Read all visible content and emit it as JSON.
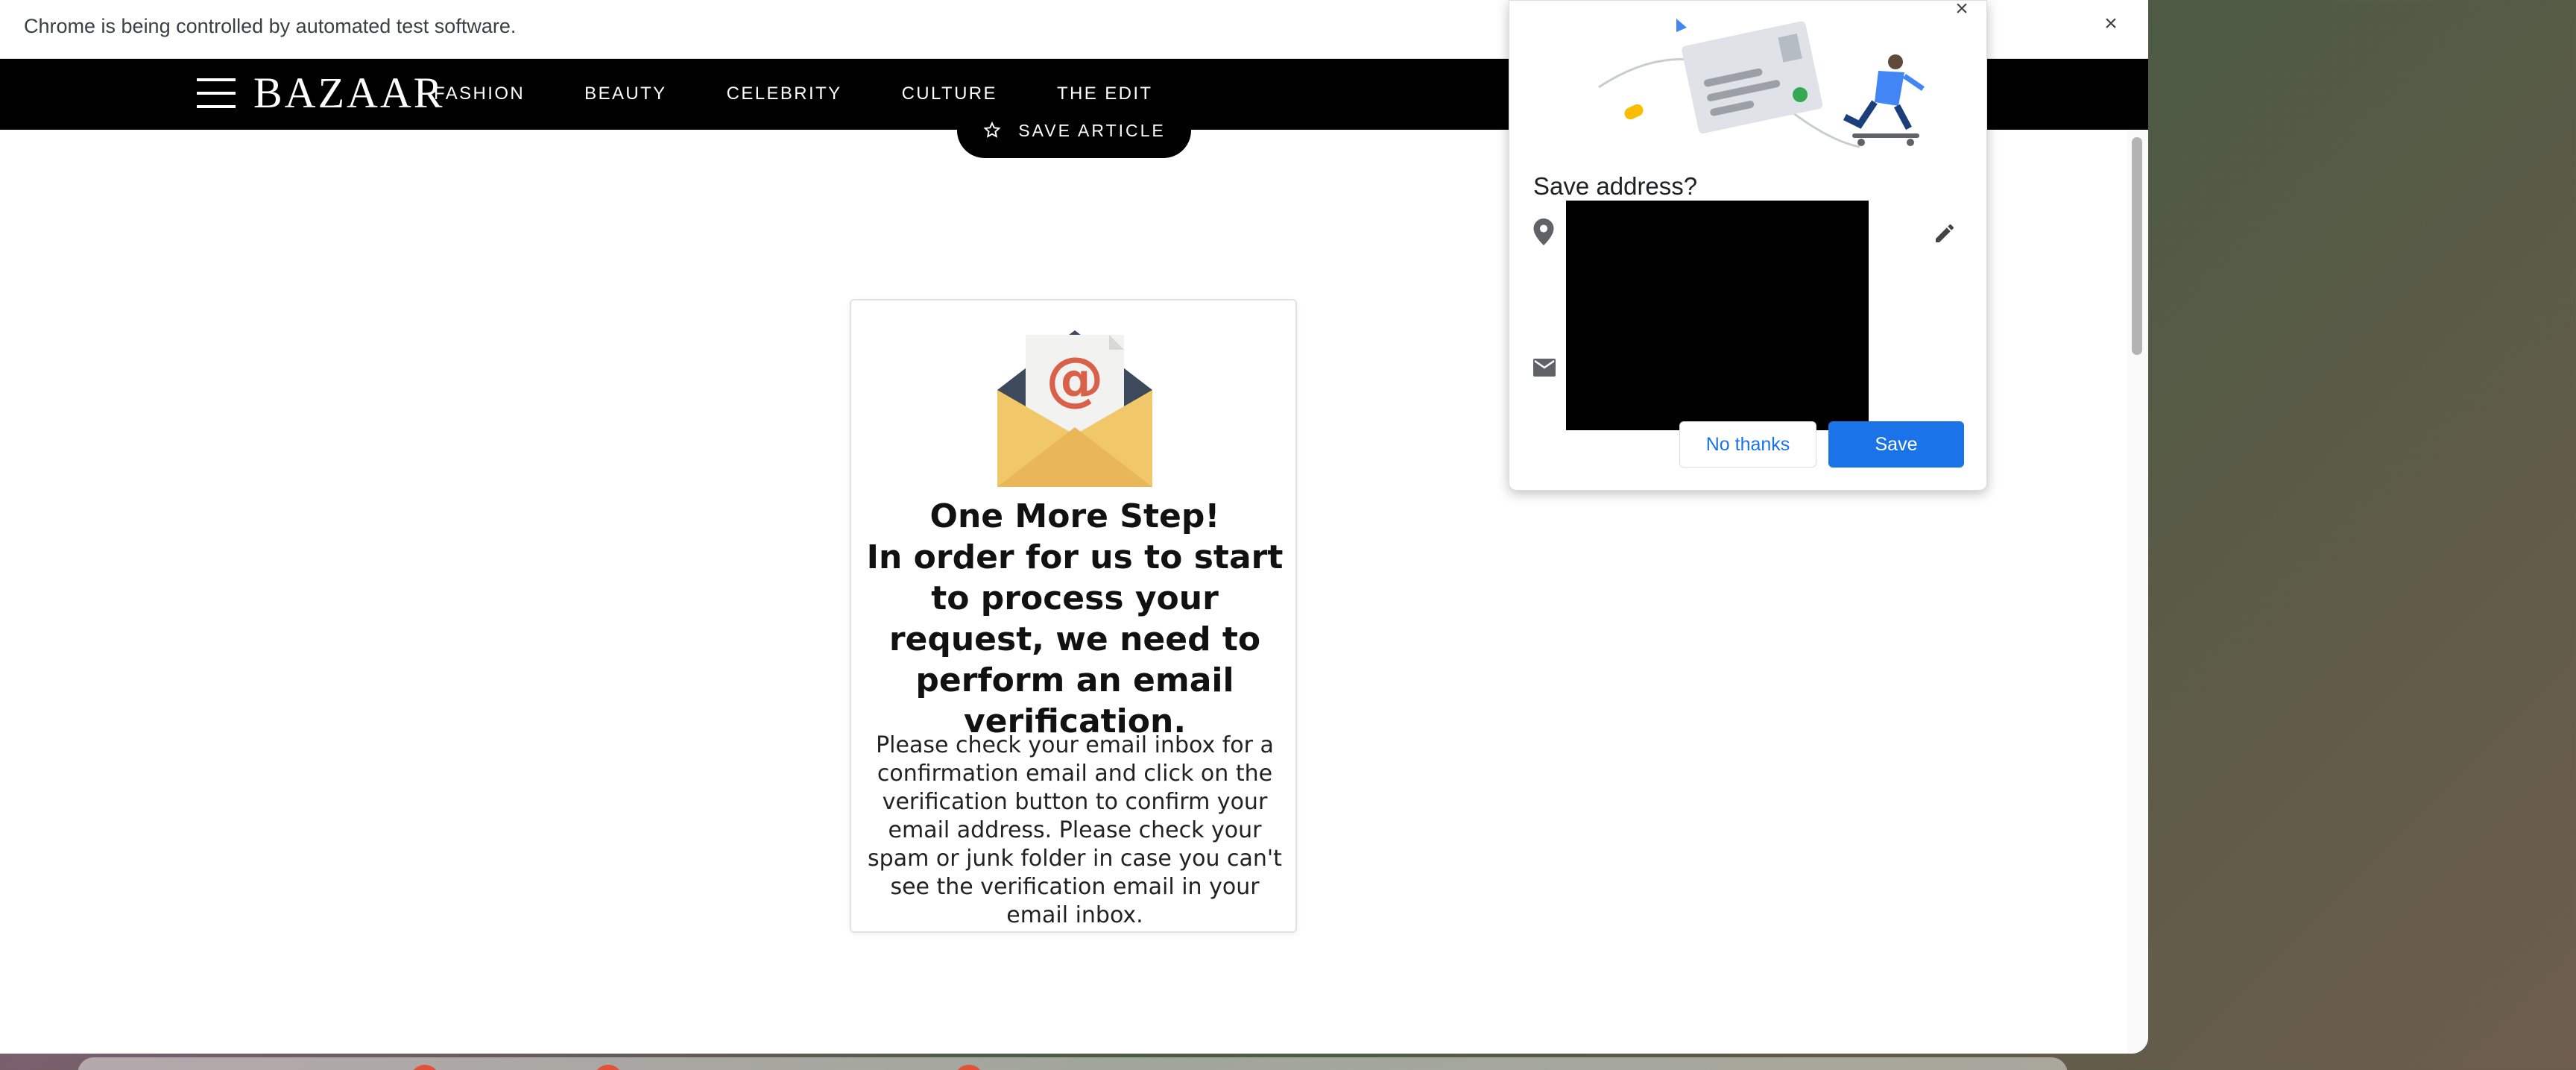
{
  "infobar": {
    "message": "Chrome is being controlled by automated test software.",
    "close_icon": "close-icon"
  },
  "site": {
    "logo": "BAZAAR",
    "menu_icon": "hamburger-menu-icon",
    "nav": [
      "FASHION",
      "BEAUTY",
      "CELEBRITY",
      "CULTURE",
      "THE EDIT"
    ],
    "save_article": "SAVE ARTICLE",
    "save_icon": "bookmark-star-icon"
  },
  "card": {
    "icon": "email-envelope-icon",
    "heading_line1": "One More Step!",
    "heading_rest": "In order for us to start to process your request, we need to perform an email verification.",
    "body": "Please check your email inbox for a confirmation email and click on the verification button to confirm your email address. Please check your spam or junk folder in case you can't see the verification email in your email inbox."
  },
  "dialog": {
    "title": "Save address?",
    "no_thanks": "No thanks",
    "save": "Save",
    "icons": [
      "location-pin-icon",
      "mail-icon",
      "edit-pencil-icon",
      "close-icon"
    ],
    "colors": {
      "primary": "#1a73e8"
    }
  }
}
